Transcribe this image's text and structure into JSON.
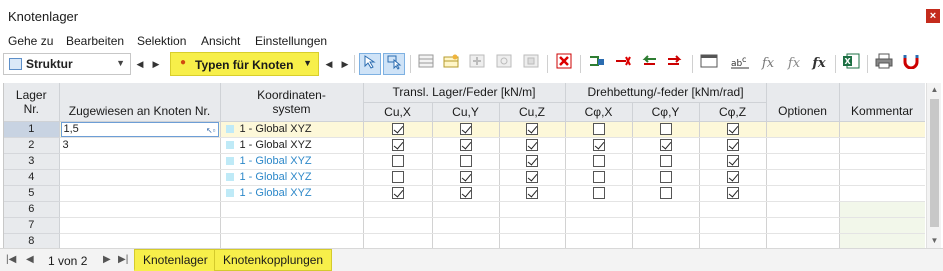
{
  "window": {
    "title": "Knotenlager",
    "close_glyph": "×"
  },
  "menu": [
    "Gehe zu",
    "Bearbeiten",
    "Selektion",
    "Ansicht",
    "Einstellungen"
  ],
  "toolbar": {
    "structure_combo": "Struktur",
    "type_combo": "Typen für Knoten"
  },
  "table": {
    "headers": {
      "nr_top": "Lager",
      "nr_bottom": "Nr.",
      "assigned": "Zugewiesen an Knoten Nr.",
      "coord_top": "Koordinaten-",
      "coord_bottom": "system",
      "transl_group": "Transl. Lager/Feder [kN/m]",
      "rot_group": "Drehbettung/-feder [kNm/rad]",
      "cux": "Cu,X",
      "cuy": "Cu,Y",
      "cuz": "Cu,Z",
      "cphx": "Cφ,X",
      "cphy": "Cφ,Y",
      "cphz": "Cφ,Z",
      "options": "Optionen",
      "comment": "Kommentar"
    },
    "rows": [
      {
        "nr": "1",
        "assigned": "1,5",
        "coord": "1 - Global XYZ",
        "coord_default": false,
        "checks": [
          true,
          true,
          true,
          false,
          false,
          true
        ]
      },
      {
        "nr": "2",
        "assigned": "3",
        "coord": "1 - Global XYZ",
        "coord_default": false,
        "checks": [
          true,
          true,
          true,
          true,
          true,
          true
        ]
      },
      {
        "nr": "3",
        "assigned": "",
        "coord": "1 - Global XYZ",
        "coord_default": true,
        "checks": [
          false,
          false,
          true,
          false,
          false,
          true
        ]
      },
      {
        "nr": "4",
        "assigned": "",
        "coord": "1 - Global XYZ",
        "coord_default": true,
        "checks": [
          false,
          true,
          true,
          false,
          false,
          true
        ]
      },
      {
        "nr": "5",
        "assigned": "",
        "coord": "1 - Global XYZ",
        "coord_default": true,
        "checks": [
          true,
          true,
          true,
          false,
          false,
          true
        ]
      },
      {
        "nr": "6",
        "assigned": "",
        "coord": "",
        "coord_default": false,
        "checks": null
      },
      {
        "nr": "7",
        "assigned": "",
        "coord": "",
        "coord_default": false,
        "checks": null
      },
      {
        "nr": "8",
        "assigned": "",
        "coord": "",
        "coord_default": false,
        "checks": null
      }
    ]
  },
  "bottom": {
    "page_text": "1 von 2",
    "tabs": [
      "Knotenlager",
      "Knotenkopplungen"
    ]
  },
  "colors": {
    "accent_yellow": "#f7ef4a",
    "link_blue": "#2d88c9",
    "selected_row": "#fdf8d9"
  }
}
